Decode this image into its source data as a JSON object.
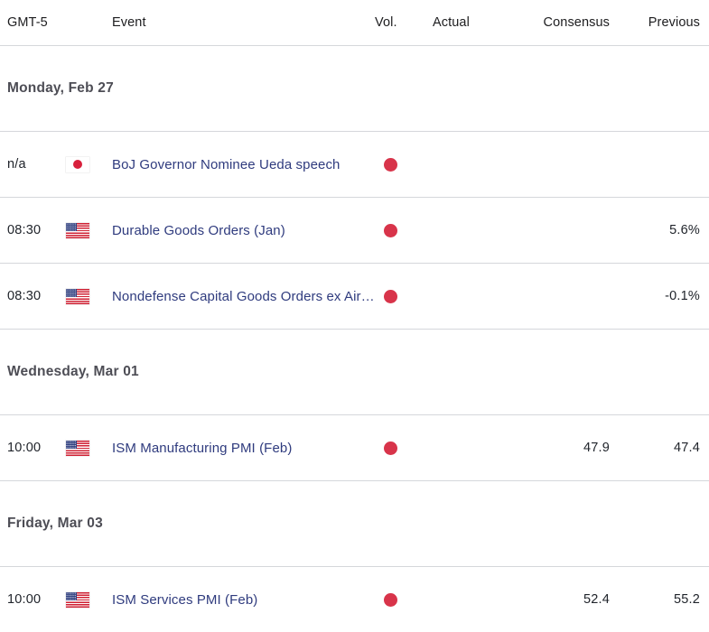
{
  "header": {
    "timezone": "GMT-5",
    "event": "Event",
    "vol": "Vol.",
    "actual": "Actual",
    "consensus": "Consensus",
    "previous": "Previous"
  },
  "colors": {
    "link": "#2f3b7e",
    "volatility_high": "#d8344a",
    "divider": "#d5d7db",
    "date_header": "#4d4d55",
    "text": "#20242b"
  },
  "groups": [
    {
      "date": "Monday, Feb 27",
      "rows": [
        {
          "time": "n/a",
          "flag": "flag-japan-icon",
          "flag_class": "flag-jp",
          "event": "BoJ Governor Nominee Ueda speech",
          "vol": "volatility-high-dot",
          "actual": "",
          "consensus": "",
          "previous": ""
        },
        {
          "time": "08:30",
          "flag": "flag-united-states-icon",
          "flag_class": "flag-us",
          "event": "Durable Goods Orders (Jan)",
          "vol": "volatility-high-dot",
          "actual": "",
          "consensus": "",
          "previous": "5.6%"
        },
        {
          "time": "08:30",
          "flag": "flag-united-states-icon",
          "flag_class": "flag-us",
          "event": "Nondefense Capital Goods Orders ex Aircraft…",
          "vol": "volatility-high-dot",
          "actual": "",
          "consensus": "",
          "previous": "-0.1%"
        }
      ]
    },
    {
      "date": "Wednesday, Mar 01",
      "rows": [
        {
          "time": "10:00",
          "flag": "flag-united-states-icon",
          "flag_class": "flag-us",
          "event": "ISM Manufacturing PMI (Feb)",
          "vol": "volatility-high-dot",
          "actual": "",
          "consensus": "47.9",
          "previous": "47.4"
        }
      ]
    },
    {
      "date": "Friday, Mar 03",
      "rows": [
        {
          "time": "10:00",
          "flag": "flag-united-states-icon",
          "flag_class": "flag-us",
          "event": "ISM Services PMI (Feb)",
          "vol": "volatility-high-dot",
          "actual": "",
          "consensus": "52.4",
          "previous": "55.2"
        }
      ]
    }
  ]
}
